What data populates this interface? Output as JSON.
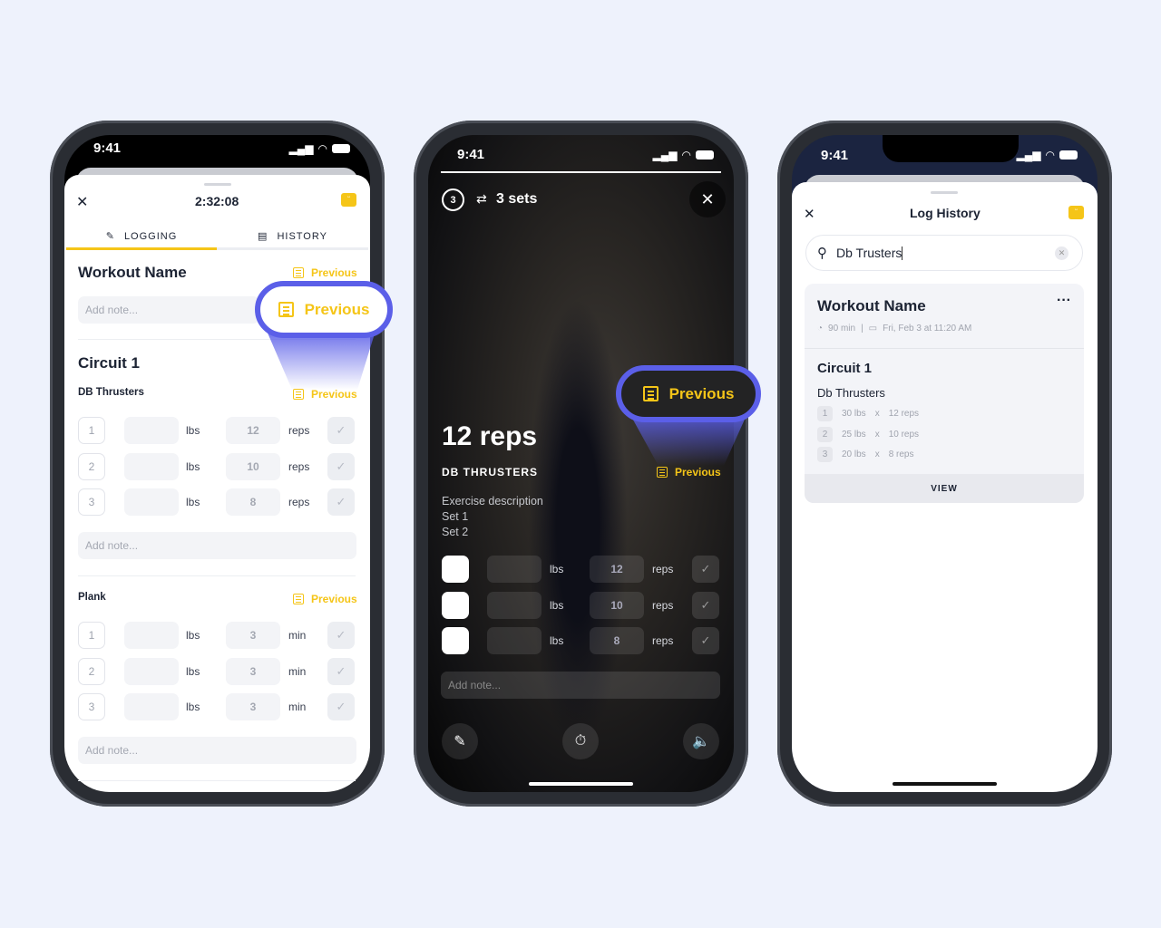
{
  "status": {
    "time": "9:41"
  },
  "logging": {
    "timer": "2:32:08",
    "tabs": [
      {
        "label": "LOGGING",
        "active": true
      },
      {
        "label": "HISTORY",
        "active": false
      }
    ],
    "workout_name": "Workout Name",
    "previous": "Previous",
    "add_note": "Add note...",
    "circuit": "Circuit 1",
    "exercises": [
      {
        "name": "DB Thrusters",
        "unit_a": "lbs",
        "unit_b": "reps",
        "sets": [
          {
            "n": "1",
            "v": "12"
          },
          {
            "n": "2",
            "v": "10"
          },
          {
            "n": "3",
            "v": "8"
          }
        ]
      },
      {
        "name": "Plank",
        "unit_a": "lbs",
        "unit_b": "min",
        "sets": [
          {
            "n": "1",
            "v": "3"
          },
          {
            "n": "2",
            "v": "3"
          },
          {
            "n": "3",
            "v": "3"
          }
        ]
      }
    ]
  },
  "player": {
    "round": "3",
    "sets": "3 sets",
    "reps": "12 reps",
    "exercise": "DB THRUSTERS",
    "previous": "Previous",
    "description": [
      "Exercise description",
      "Set 1",
      "Set 2"
    ],
    "unit_a": "lbs",
    "unit_b": "reps",
    "values": [
      "12",
      "10",
      "8"
    ],
    "add_note": "Add note..."
  },
  "history": {
    "title": "Log History",
    "search_value": "Db Trusters",
    "workout_name": "Workout Name",
    "duration": "90 min",
    "date": "Fri, Feb 3 at 11:20 AM",
    "circuit": "Circuit 1",
    "exercise": "Db Thrusters",
    "sets": [
      {
        "n": "1",
        "w": "30 lbs",
        "r": "12 reps"
      },
      {
        "n": "2",
        "w": "25 lbs",
        "r": "10 reps"
      },
      {
        "n": "3",
        "w": "20 lbs",
        "r": "8 reps"
      }
    ],
    "times": "x",
    "view": "VIEW"
  },
  "colors": {
    "accent": "#f5c518",
    "highlight": "#5b5fe8",
    "background": "#eef2fc"
  }
}
